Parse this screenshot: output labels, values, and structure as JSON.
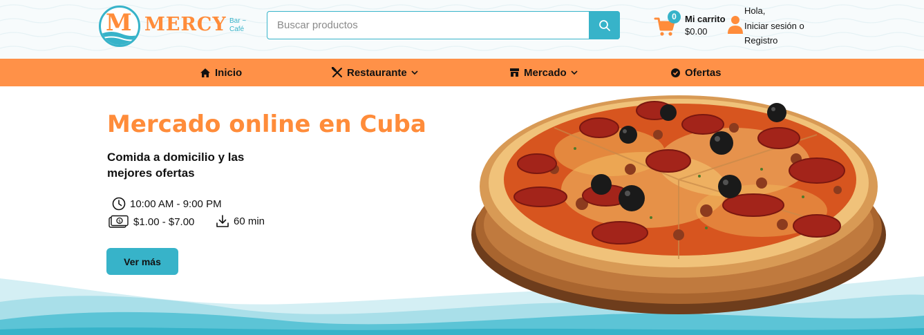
{
  "brand": {
    "logo_letter": "M",
    "name": "MERCY",
    "tagline_line1": "Bar ~",
    "tagline_line2": "Café",
    "colors": {
      "primary": "#37b3c9",
      "accent": "#ff8c3a",
      "nav": "#ff9148"
    }
  },
  "search": {
    "placeholder": "Buscar productos",
    "value": "",
    "icon": "search-icon"
  },
  "cart": {
    "count": "0",
    "label": "Mi carrito",
    "total": "$0.00",
    "icon": "cart-icon"
  },
  "account": {
    "greeting": "Hola,",
    "login": "Iniciar sesión o",
    "register": "Registro",
    "icon": "user-icon"
  },
  "nav": {
    "items": [
      {
        "label": "Inicio",
        "icon": "home-icon"
      },
      {
        "label": "Restaurante",
        "icon": "utensils-icon",
        "dropdown": true
      },
      {
        "label": "Mercado",
        "icon": "store-icon",
        "dropdown": true
      },
      {
        "label": "Ofertas",
        "icon": "badge-icon"
      }
    ]
  },
  "hero": {
    "title": "Mercado online en Cuba",
    "subtitle": "Comida a domicilio y las mejores ofertas",
    "hours": "10:00 AM - 9:00 PM",
    "price_range": "$1.00 - $7.00",
    "delivery_time": "60 min",
    "cta_label": "Ver más",
    "image": "pizza-image"
  }
}
